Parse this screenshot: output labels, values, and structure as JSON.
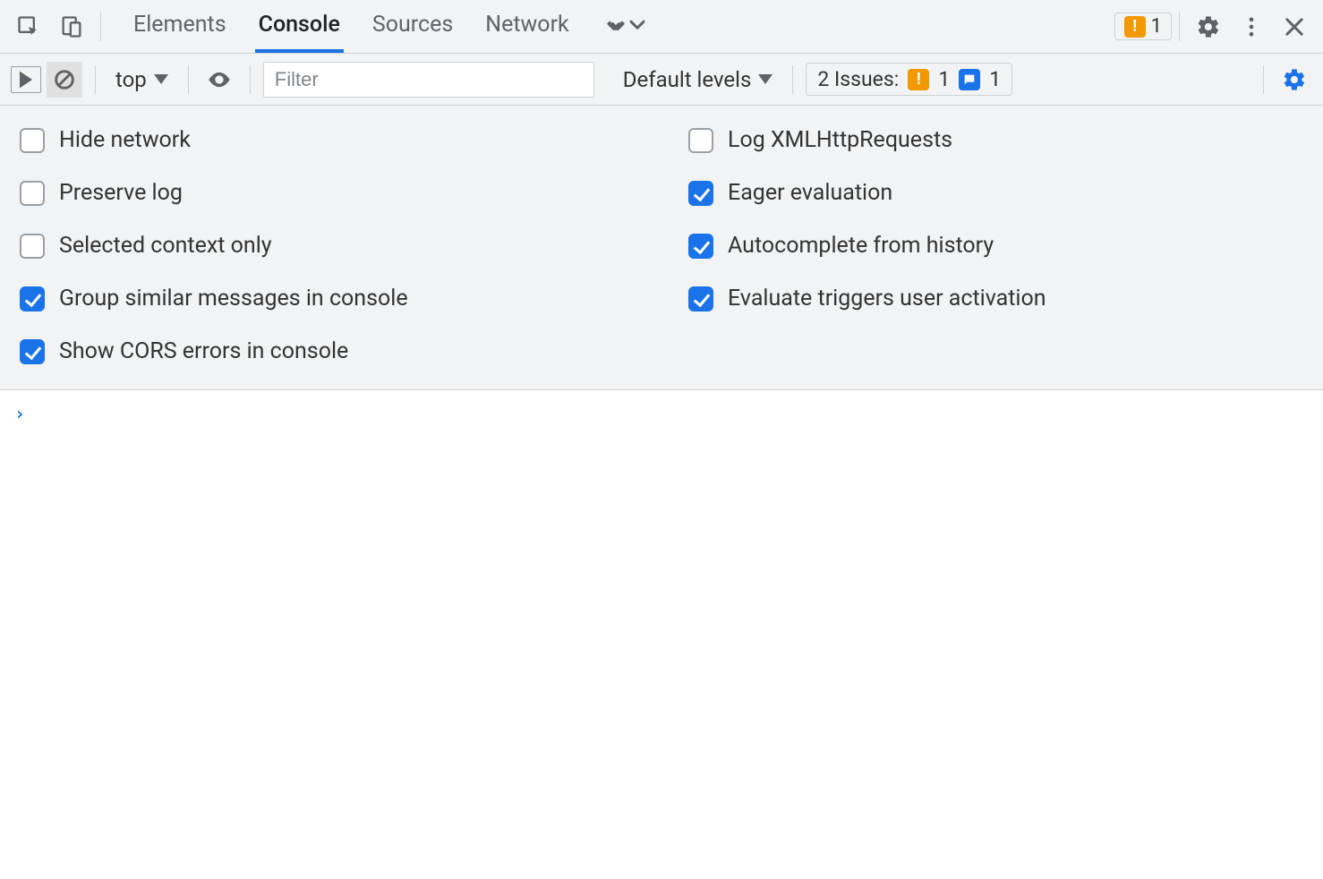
{
  "tabs": {
    "items": [
      "Elements",
      "Console",
      "Sources",
      "Network"
    ],
    "active_index": 1
  },
  "header": {
    "warning_count": "1"
  },
  "toolbar": {
    "context_label": "top",
    "filter_placeholder": "Filter",
    "levels_label": "Default levels",
    "issues_label": "2 Issues:",
    "issues_warning_count": "1",
    "issues_info_count": "1"
  },
  "settings": {
    "left": [
      {
        "label": "Hide network",
        "checked": false
      },
      {
        "label": "Preserve log",
        "checked": false
      },
      {
        "label": "Selected context only",
        "checked": false
      },
      {
        "label": "Group similar messages in console",
        "checked": true
      },
      {
        "label": "Show CORS errors in console",
        "checked": true
      }
    ],
    "right": [
      {
        "label": "Log XMLHttpRequests",
        "checked": false
      },
      {
        "label": "Eager evaluation",
        "checked": true
      },
      {
        "label": "Autocomplete from history",
        "checked": true
      },
      {
        "label": "Evaluate triggers user activation",
        "checked": true
      }
    ]
  },
  "console": {
    "prompt": "›"
  }
}
